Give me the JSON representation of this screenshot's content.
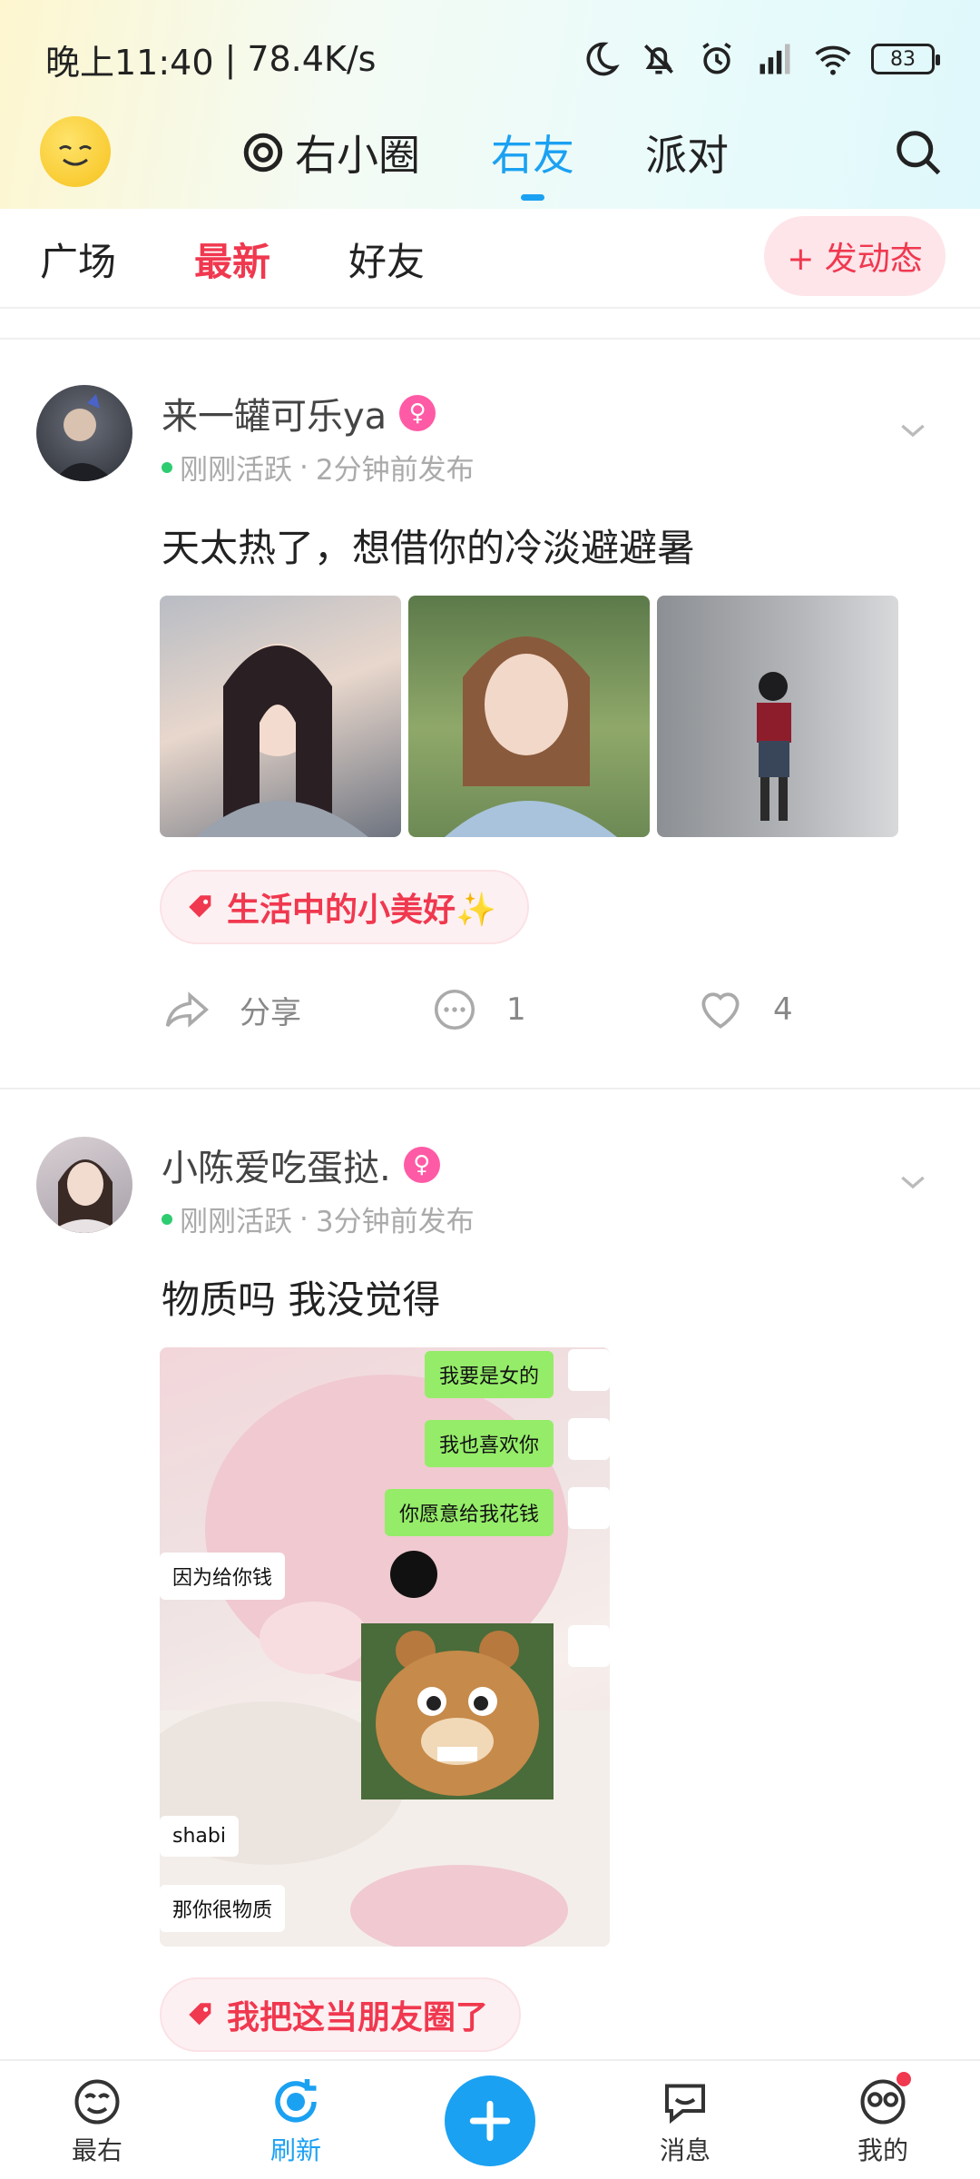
{
  "status_bar": {
    "time": "晚上11:40",
    "separator": "|",
    "speed": "78.4K/s",
    "battery": "83"
  },
  "top_nav": {
    "tabs": [
      {
        "label": "右小圈"
      },
      {
        "label": "右友"
      },
      {
        "label": "派对"
      }
    ],
    "active_tab": "右友"
  },
  "sub_nav": {
    "tabs": [
      {
        "label": "广场"
      },
      {
        "label": "最新"
      },
      {
        "label": "好友"
      }
    ],
    "active_tab": "最新",
    "post_button": "+ 发动态"
  },
  "posts": [
    {
      "username": "来一罐可乐ya",
      "gender": "♀",
      "status": "刚刚活跃",
      "dot": "·",
      "time": "2分钟前发布",
      "text": "天太热了，想借你的冷淡避避暑",
      "tag": "生活中的小美好✨",
      "share_label": "分享",
      "comments": "1",
      "likes": "4"
    },
    {
      "username": "小陈爱吃蛋挞.",
      "gender": "♀",
      "status": "刚刚活跃",
      "dot": "·",
      "time": "3分钟前发布",
      "text": "物质吗  我没觉得",
      "tag": "我把这当朋友圈了",
      "chat": {
        "b1": "我要是女的",
        "b2": "我也喜欢你",
        "b3": "你愿意给我花钱",
        "w1": "因为给你钱",
        "w2": "shabi",
        "w3": "那你很物质"
      }
    }
  ],
  "bottom_nav": {
    "items": [
      {
        "label": "最右"
      },
      {
        "label": "刷新"
      },
      {
        "label": "消息"
      },
      {
        "label": "我的"
      }
    ],
    "active": "刷新"
  },
  "colors": {
    "accent_blue": "#1ba1f2",
    "accent_red": "#f0384f"
  }
}
